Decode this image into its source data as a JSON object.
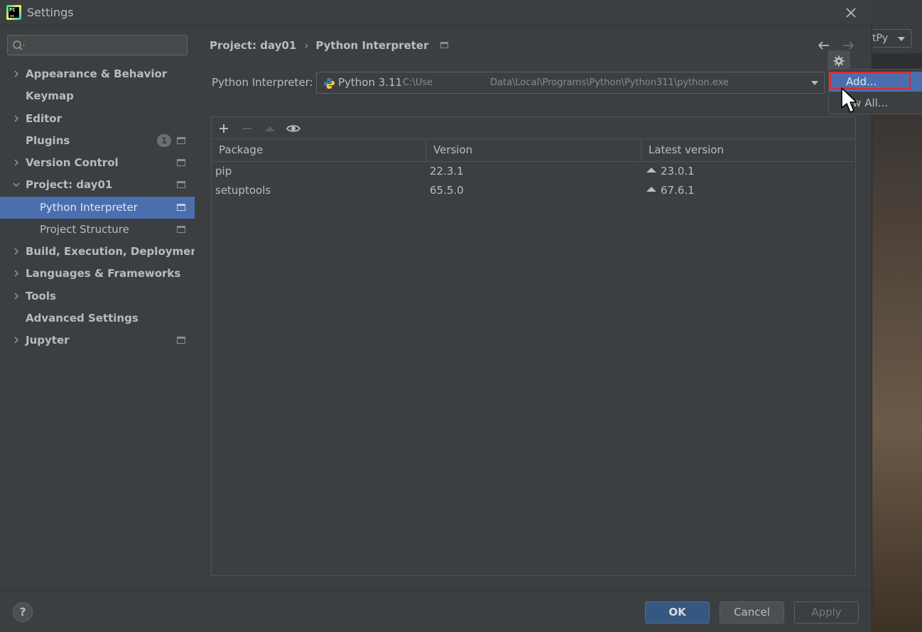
{
  "window": {
    "title": "Settings"
  },
  "background": {
    "button_label": "tPy"
  },
  "sidebar": {
    "search_placeholder": "",
    "items": [
      {
        "label": "Appearance & Behavior"
      },
      {
        "label": "Keymap"
      },
      {
        "label": "Editor"
      },
      {
        "label": "Plugins",
        "badge": "1"
      },
      {
        "label": "Version Control"
      },
      {
        "label": "Project: day01"
      },
      {
        "label": "Python Interpreter"
      },
      {
        "label": "Project Structure"
      },
      {
        "label": "Build, Execution, Deployment"
      },
      {
        "label": "Languages & Frameworks"
      },
      {
        "label": "Tools"
      },
      {
        "label": "Advanced Settings"
      },
      {
        "label": "Jupyter"
      }
    ],
    "selected": "Python Interpreter"
  },
  "breadcrumb": {
    "parent": "Project: day01",
    "current": "Python Interpreter"
  },
  "interpreter": {
    "label": "Python Interpreter:",
    "name": "Python 3.11",
    "path_start": "C:\\User",
    "path_end": "Data\\Local\\Programs\\Python\\Python311\\python.exe"
  },
  "packages": {
    "columns": [
      "Package",
      "Version",
      "Latest version"
    ],
    "rows": [
      {
        "package": "pip",
        "version": "22.3.1",
        "latest": "23.0.1"
      },
      {
        "package": "setuptools",
        "version": "65.5.0",
        "latest": "67.6.1"
      }
    ]
  },
  "gear_menu": {
    "items": [
      "Add...",
      "ow All..."
    ]
  },
  "buttons": {
    "help": "?",
    "ok": "OK",
    "cancel": "Cancel",
    "apply": "Apply"
  },
  "colors": {
    "selection": "#4b6eaf",
    "ok_button": "#365880",
    "highlight_box": "#e0282e"
  }
}
